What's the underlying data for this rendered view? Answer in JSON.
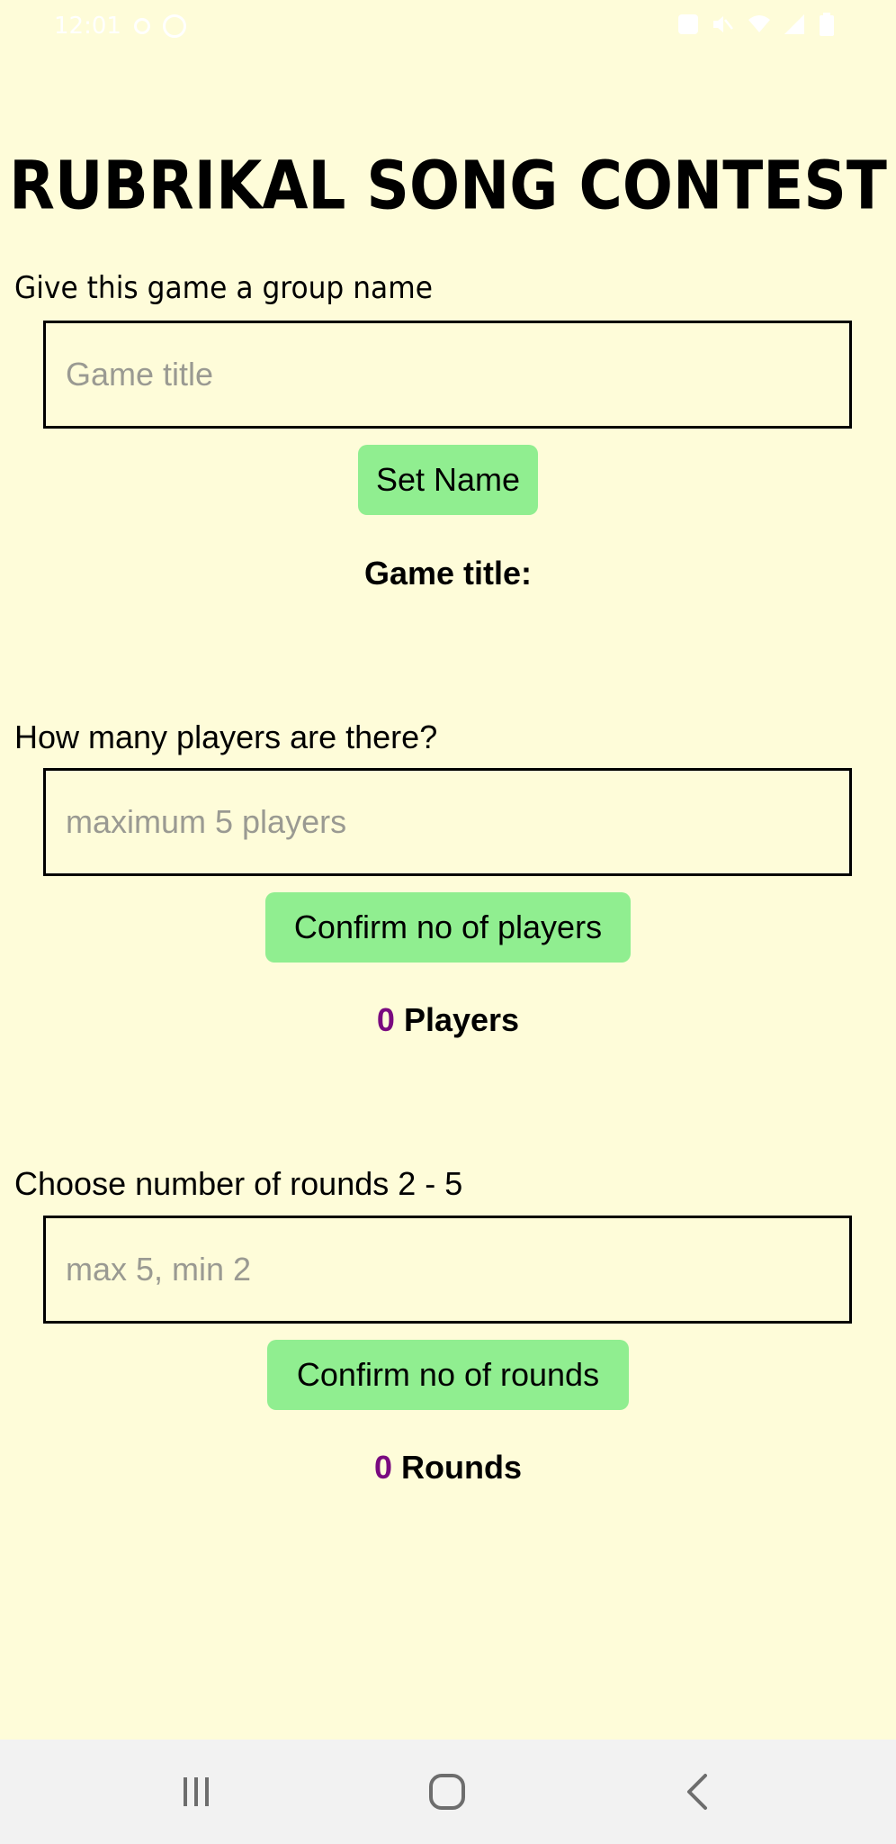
{
  "status_bar": {
    "time": "12:01",
    "left_icons": [
      "signal-indicator-icon",
      "notification-icon"
    ],
    "right_icons": [
      "nfc-icon",
      "mute-icon",
      "wifi-icon",
      "signal-icon",
      "battery-icon"
    ]
  },
  "app": {
    "title": "RUBRIKAL SONG CONTEST"
  },
  "game_name": {
    "label": "Give this game a group name",
    "placeholder": "Game title",
    "value": "",
    "button": "Set Name",
    "result_label": "Game title:"
  },
  "players": {
    "label": "How many players are there?",
    "placeholder": "maximum 5 players",
    "value": "",
    "button": "Confirm no of players",
    "count": "0",
    "count_suffix": " Players"
  },
  "rounds": {
    "label": "Choose number of rounds 2 - 5",
    "placeholder": "max 5, min 2",
    "value": "",
    "button": "Confirm no of rounds",
    "count": "0",
    "count_suffix": " Rounds"
  },
  "nav_bar": {
    "icons": [
      "recent-apps-icon",
      "home-icon",
      "back-icon"
    ]
  },
  "colors": {
    "background": "#fefcd9",
    "button": "#90ee90",
    "count_accent": "#7a0a80",
    "nav_bar": "#f2f2f2"
  }
}
